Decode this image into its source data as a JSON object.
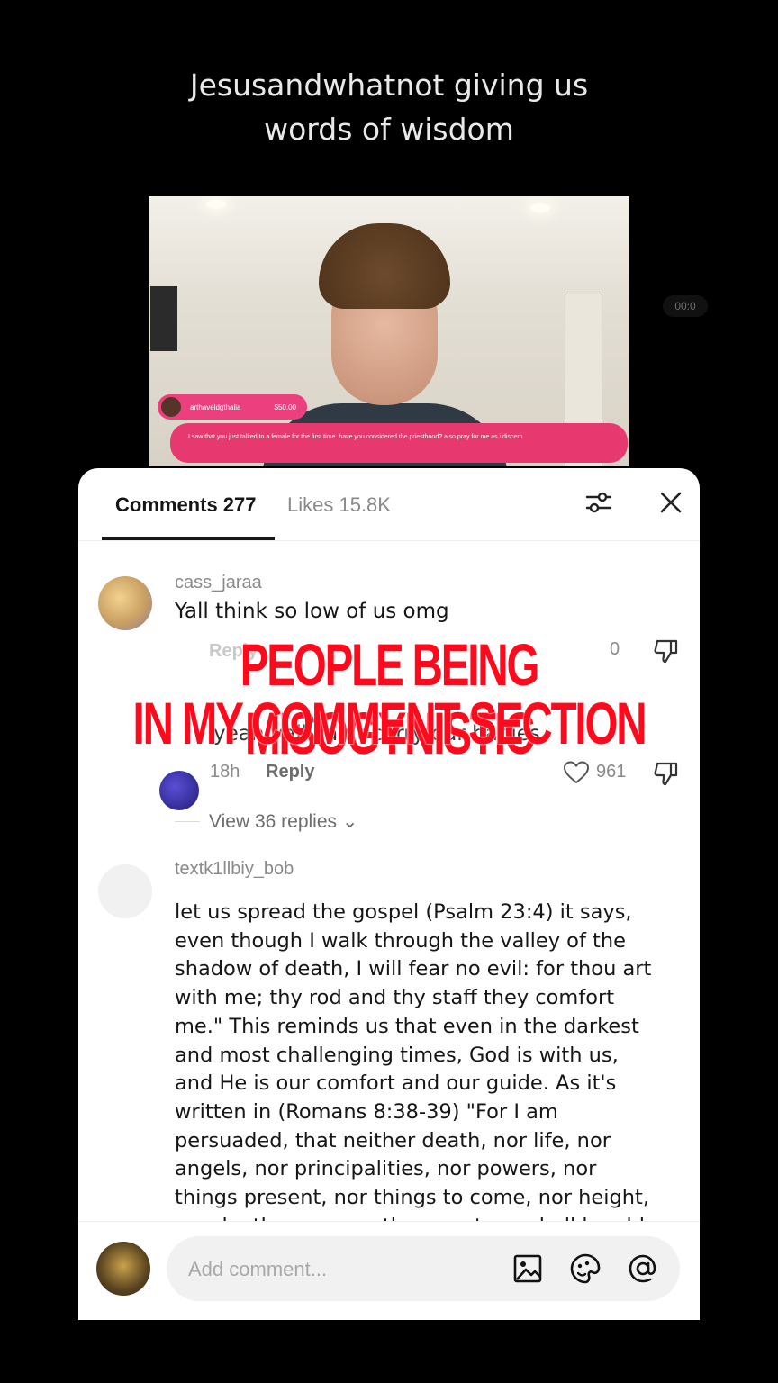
{
  "caption": {
    "line1": "Jesusandwhatnot giving us",
    "line2": "words of wisdom"
  },
  "video": {
    "donation_name": "arthaveldgthalia",
    "donation_amount": "$50.00",
    "donation_message": "I saw that you just talked to a female for the first time. have you considered the priesthood? also pray for me as i discern",
    "timer": "00:0"
  },
  "panel": {
    "tab_comments": "Comments 277",
    "tab_likes": "Likes 15.8K",
    "filter_icon": "sliders-icon",
    "close_icon": "close-icon"
  },
  "comments": [
    {
      "username": "cass_jaraa",
      "text": "Yall think so low of us omg",
      "time": "",
      "reply_label": "Reply",
      "likes": "0"
    },
    {
      "username": "",
      "text": "yeah yall can't carry our babies",
      "time": "18h",
      "reply_label": "Reply",
      "likes": "961",
      "view_replies": "View 36 replies"
    },
    {
      "username": "textk1llbiy_bob",
      "text": "let us spread the gospel (Psalm 23:4) it says,\neven though I walk through the valley of the\nshadow of death, I will fear no evil: for thou art\nwith me; thy rod and thy staff they comfort\nme.\" This reminds us that even in the darkest\nand most challenging times, God is with us,\nand He is our comfort and our guide. As it's\nwritten in (Romans 8:38-39) \"For I am\npersuaded, that neither death, nor life, nor\nangels, nor principalities, nor powers, nor\nthings present, nor things to come, nor height,\nnor depth, nor any other creature, shall be able"
    }
  ],
  "overlay": {
    "line1": "PEOPLE BEING MISOGYNISTIC",
    "line2": "IN MY COMMENT SECTION"
  },
  "composer": {
    "placeholder": "Add comment...",
    "icons": [
      "image-icon",
      "emoji-icon",
      "mention-icon"
    ]
  },
  "colors": {
    "overlay_red": "#ff0a1d",
    "donation_pink": "#e7396f"
  }
}
